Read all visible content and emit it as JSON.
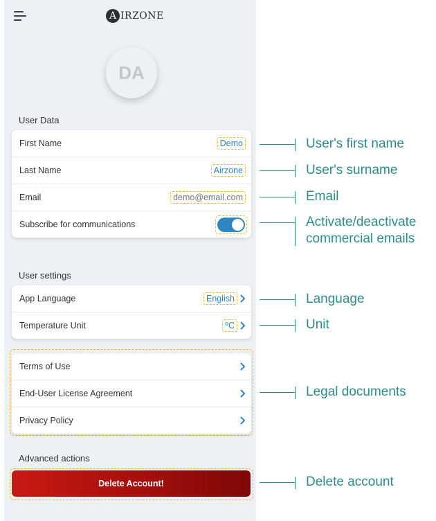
{
  "header": {
    "menu_icon": "hamburger-menu-icon",
    "logo_letter": "A",
    "logo_text": "IRZONE"
  },
  "avatar": {
    "initials": "DA"
  },
  "user_data": {
    "title": "User Data",
    "rows": [
      {
        "label": "First Name",
        "value": "Demo"
      },
      {
        "label": "Last Name",
        "value": "Airzone"
      },
      {
        "label": "Email",
        "value": "demo@email.com"
      },
      {
        "label": "Subscribe for communications",
        "toggle_on": true
      }
    ]
  },
  "user_settings": {
    "title": "User settings",
    "rows": [
      {
        "label": "App Language",
        "value": "English"
      },
      {
        "label": "Temperature Unit",
        "value": "ºC"
      }
    ]
  },
  "legal": {
    "rows": [
      {
        "label": "Terms of Use"
      },
      {
        "label": "End-User License Agreement"
      },
      {
        "label": "Privacy Policy"
      }
    ]
  },
  "advanced": {
    "title": "Advanced actions",
    "delete_label": "Delete Account!"
  },
  "callouts": {
    "first_name": "User's first name",
    "surname": "User's surname",
    "email": "Email",
    "commercial_line1": "Activate/deactivate",
    "commercial_line2": "commercial emails",
    "language": "Language",
    "unit": "Unit",
    "legal": "Legal documents",
    "delete": "Delete account"
  },
  "colors": {
    "accent": "#2f86c3",
    "annotation": "#2f8a8a",
    "highlight_dash": "#f2b233",
    "delete_start": "#c91a14",
    "delete_end": "#7e0806",
    "background": "#edf0f4"
  }
}
